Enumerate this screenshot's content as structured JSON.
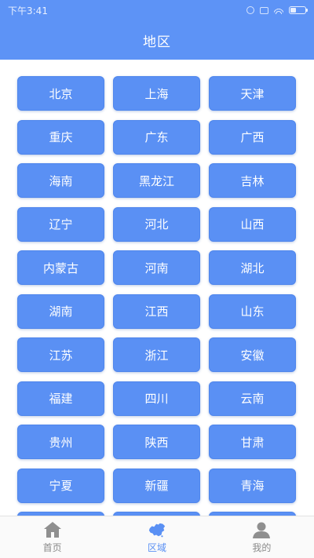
{
  "status_bar": {
    "time": "下午3:41"
  },
  "header": {
    "title": "地区"
  },
  "regions": [
    "北京",
    "上海",
    "天津",
    "重庆",
    "广东",
    "广西",
    "海南",
    "黑龙江",
    "吉林",
    "辽宁",
    "河北",
    "山西",
    "内蒙古",
    "河南",
    "湖北",
    "湖南",
    "江西",
    "山东",
    "江苏",
    "浙江",
    "安徽",
    "福建",
    "四川",
    "云南",
    "贵州",
    "陕西",
    "甘肃",
    "宁夏",
    "新疆",
    "青海",
    "",
    "",
    ""
  ],
  "tabbar": {
    "tabs": [
      {
        "label": "首页",
        "icon": "home-icon",
        "active": false
      },
      {
        "label": "区域",
        "icon": "china-map-icon",
        "active": true
      },
      {
        "label": "我的",
        "icon": "user-icon",
        "active": false
      }
    ]
  },
  "colors": {
    "primary": "#5d93f6",
    "button": "#5a90f4",
    "tab_active": "#5a90f4",
    "tab_inactive": "#8a8a8a"
  }
}
